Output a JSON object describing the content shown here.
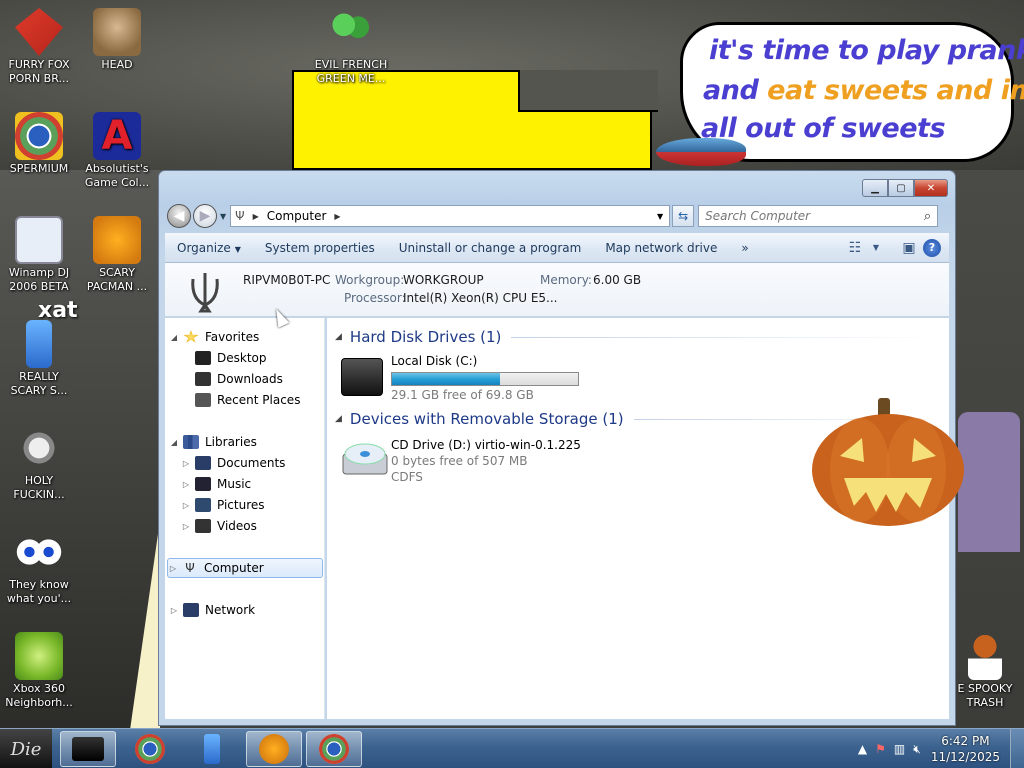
{
  "desktop": {
    "speech_bubble": {
      "line1": "it's time to play pranks",
      "line2_a": "and ",
      "line2_b": "eat sweets and im",
      "line3": "all out of sweets"
    },
    "icons_left": [
      {
        "label": "FURRY FOX\nPORN BR...",
        "icon": "fox-icon"
      },
      {
        "label": "SPERMIUM",
        "icon": "chrome-icon"
      },
      {
        "label": "Winamp DJ\n2006 BETA",
        "icon": "winamp-icon"
      },
      {
        "label": "REALLY\nSCARY S...",
        "icon": "usb-icon"
      },
      {
        "label": "HOLY\nFUCKIN...",
        "icon": "spider-icon"
      },
      {
        "label": "They know\nwhat you'...",
        "icon": "eyes-icon"
      },
      {
        "label": "Xbox 360\nNeighborh...",
        "icon": "xbox-icon"
      }
    ],
    "icons_col2": [
      {
        "label": "HEAD",
        "icon": "head-icon"
      },
      {
        "label": "Absolutist's\nGame Col...",
        "icon": "absolutist-icon"
      },
      {
        "label": "SCARY\nPACMAN ...",
        "icon": "pacman-icon"
      }
    ],
    "icon_top": {
      "label": "EVIL FRENCH\nGREEN ME...",
      "icon": "messenger-icon"
    },
    "icon_right": {
      "label": "E SPOOKY\nTRASH",
      "icon": "trash-icon"
    },
    "xat_text": "xat"
  },
  "window": {
    "breadcrumb": "Computer",
    "search_placeholder": "Search Computer",
    "toolbar": {
      "organize": "Organize",
      "system_properties": "System properties",
      "uninstall": "Uninstall or change a program",
      "map_drive": "Map network drive",
      "more": "»"
    },
    "details": {
      "pc_name": "RIPVM0B0T-PC",
      "workgroup_label": "Workgroup:",
      "workgroup": "WORKGROUP",
      "memory_label": "Memory:",
      "memory": "6.00 GB",
      "processor_label": "Processor:",
      "processor": "Intel(R) Xeon(R) CPU E5..."
    },
    "nav": {
      "favorites": "Favorites",
      "desktop": "Desktop",
      "downloads": "Downloads",
      "recent": "Recent Places",
      "libraries": "Libraries",
      "documents": "Documents",
      "music": "Music",
      "pictures": "Pictures",
      "videos": "Videos",
      "computer": "Computer",
      "network": "Network"
    },
    "groups": {
      "hdd": "Hard Disk Drives (1)",
      "removable": "Devices with Removable Storage (1)"
    },
    "drives": {
      "c_name": "Local Disk (C:)",
      "c_free": "29.1 GB free of 69.8 GB",
      "c_used_fraction": 0.583,
      "d_name": "CD Drive (D:) virtio-win-0.1.225",
      "d_free": "0 bytes free of 507 MB",
      "d_fs": "CDFS"
    }
  },
  "taskbar": {
    "start": "Die",
    "clock_time": "6:42 PM",
    "clock_date": "11/12/2025"
  }
}
